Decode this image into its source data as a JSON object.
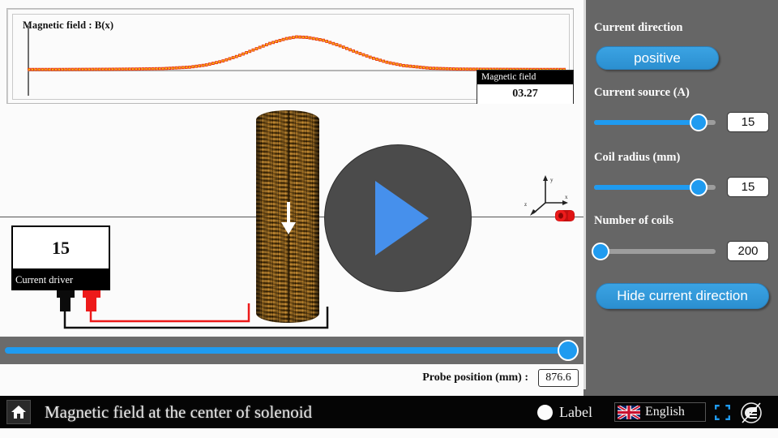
{
  "graph": {
    "title": "Magnetic field : B(x)",
    "readout_label": "Magnetic field",
    "readout_value": "03.27"
  },
  "chart_data": {
    "type": "line",
    "title": "Magnetic field : B(x)",
    "xlabel": "x",
    "ylabel": "B(x)",
    "grid": false,
    "legend": "none",
    "marker": "square-dot",
    "series_color": "#e8380d",
    "baseline_y": 0,
    "peak_value": 3.27,
    "peak_x_fraction": 0.5,
    "x": [
      0.0,
      0.05,
      0.1,
      0.15,
      0.2,
      0.25,
      0.3,
      0.33,
      0.36,
      0.39,
      0.42,
      0.45,
      0.48,
      0.5,
      0.52,
      0.55,
      0.58,
      0.61,
      0.64,
      0.67,
      0.7,
      0.75,
      0.8,
      0.85,
      0.9,
      0.95,
      1.0
    ],
    "values": [
      0.18,
      0.18,
      0.19,
      0.2,
      0.22,
      0.26,
      0.4,
      0.6,
      0.95,
      1.45,
      2.05,
      2.65,
      3.1,
      3.27,
      3.22,
      2.95,
      2.45,
      1.85,
      1.3,
      0.85,
      0.55,
      0.3,
      0.22,
      0.2,
      0.19,
      0.18,
      0.18
    ],
    "ylim": [
      0,
      4
    ]
  },
  "driver": {
    "value": "15",
    "label": "Current driver"
  },
  "probe": {
    "label": "Probe position (mm) :",
    "value": "876.6",
    "slider_fraction": 0.98
  },
  "panel": {
    "current_direction": {
      "label": "Current direction",
      "button": "positive"
    },
    "current_source": {
      "label": "Current source (A)",
      "value": "15",
      "fraction": 0.86
    },
    "coil_radius": {
      "label": "Coil radius (mm)",
      "value": "15",
      "fraction": 0.86
    },
    "number_of_coils": {
      "label": "Number of coils",
      "value": "200",
      "fraction": 0.05
    },
    "hide_button": "Hide current direction"
  },
  "axes": {
    "y": "y",
    "x": "x",
    "z": "z"
  },
  "bottom": {
    "title": "Magnetic field at the center of solenoid",
    "label_toggle": "Label",
    "language": "English",
    "home_icon": "home-icon",
    "fullscreen_icon": "fullscreen-icon",
    "brand_icon": "brand-logo-icon"
  },
  "colors": {
    "accent": "#1f9bf0",
    "panel_bg": "#666666",
    "curve": "#e8380d",
    "coil": "#a5711c",
    "disc": "#4b4b4b",
    "play": "#4690ec"
  }
}
